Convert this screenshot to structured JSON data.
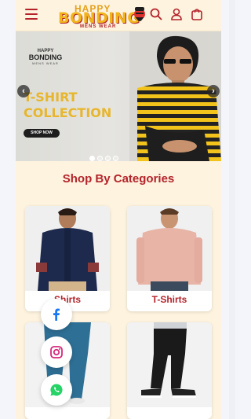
{
  "header": {
    "logo": {
      "line1": "HAPPY",
      "line2": "BONDING",
      "line3": "MENS WEAR"
    },
    "icons": [
      "menu-icon",
      "search-icon",
      "user-icon",
      "cart-icon"
    ]
  },
  "hero": {
    "brand": {
      "line1": "HAPPY",
      "line2": "BONDING",
      "line3": "MENS WEAR"
    },
    "title_line1": "T-SHIRT",
    "title_line2": "COLLECTION",
    "cta": "SHOP NOW",
    "prev": "‹",
    "next": "›",
    "slides": 4,
    "active_slide": 1
  },
  "categories": {
    "title": "Shop By Categories",
    "items": [
      {
        "label": "Shirts"
      },
      {
        "label": "T-Shirts"
      },
      {
        "label": ""
      },
      {
        "label": ""
      }
    ]
  },
  "social": [
    "facebook-icon",
    "instagram-icon",
    "whatsapp-icon"
  ],
  "colors": {
    "accent": "#b4232a",
    "background": "#fdf3df",
    "gold": "#e7b62c"
  }
}
